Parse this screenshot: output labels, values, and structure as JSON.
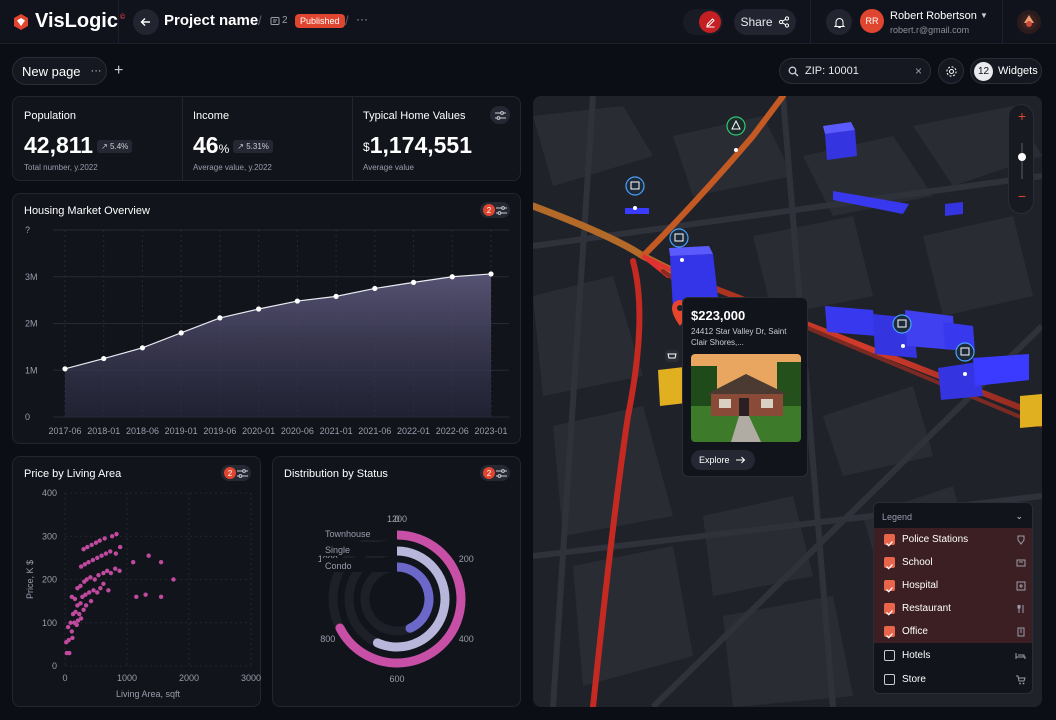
{
  "app": {
    "name": "VisLogic",
    "trademark": "©"
  },
  "header": {
    "project_name": "Project name",
    "page_count": "2",
    "status": "Published",
    "more": "···",
    "share_label": "Share",
    "user": {
      "initials": "RR",
      "name": "Robert Robertson",
      "email": "robert.r@gmail.com"
    }
  },
  "toolbar": {
    "page_name": "New page",
    "page_more": "···",
    "add_page": "+",
    "search_value": "ZIP: 10001",
    "search_clear": "×",
    "widgets_count": "12",
    "widgets_label": "Widgets"
  },
  "stats": [
    {
      "label": "Population",
      "value": "42,811",
      "change": "↗ 5.4%",
      "sub": "Total number, y.2022"
    },
    {
      "label": "Income",
      "value": "46",
      "unit": "%",
      "change": "↗ 5.31%",
      "sub": "Average value, y.2022"
    },
    {
      "label": "Typical Home Values",
      "currency": "$",
      "value": "1,174,551",
      "sub": "Average value"
    }
  ],
  "housing": {
    "title": "Housing Market Overview",
    "badge": "2"
  },
  "scatter_card": {
    "title": "Price by Living Area",
    "badge": "2"
  },
  "status_card": {
    "title": "Distribution by Status",
    "badge": "2"
  },
  "chart_data": [
    {
      "type": "area",
      "title": "Housing Market Overview",
      "y_ticks": [
        "0",
        "1M",
        "2M",
        "3M",
        "?"
      ],
      "ylim": [
        0,
        4000000
      ],
      "x_ticks": [
        "2017-06",
        "2018-01",
        "2018-06",
        "2019-01",
        "2019-06",
        "2020-01",
        "2020-06",
        "2021-01",
        "2021-06",
        "2022-01",
        "2022-06",
        "2023-01"
      ],
      "x": [
        0,
        1,
        2,
        3,
        4,
        5,
        6,
        7,
        8,
        9,
        10,
        11
      ],
      "values": [
        1030000,
        1250000,
        1480000,
        1800000,
        2120000,
        2310000,
        2480000,
        2580000,
        2750000,
        2880000,
        3000000,
        3060000
      ],
      "grid": true
    },
    {
      "type": "scatter",
      "title": "Price by Living Area",
      "xlabel": "Living Area, sqft",
      "ylabel": "Price, K $",
      "xlim": [
        0,
        3000
      ],
      "ylim": [
        0,
        400
      ],
      "x_ticks": [
        "0",
        "1000",
        "2000",
        "3000"
      ],
      "y_ticks": [
        "0",
        "100",
        "200",
        "300",
        "400"
      ],
      "points": [
        [
          30,
          30
        ],
        [
          70,
          30
        ],
        [
          20,
          55
        ],
        [
          60,
          60
        ],
        [
          120,
          65
        ],
        [
          110,
          80
        ],
        [
          50,
          90
        ],
        [
          90,
          100
        ],
        [
          150,
          100
        ],
        [
          190,
          95
        ],
        [
          210,
          105
        ],
        [
          260,
          110
        ],
        [
          130,
          120
        ],
        [
          170,
          125
        ],
        [
          230,
          120
        ],
        [
          300,
          130
        ],
        [
          200,
          140
        ],
        [
          250,
          145
        ],
        [
          340,
          140
        ],
        [
          420,
          150
        ],
        [
          110,
          160
        ],
        [
          160,
          155
        ],
        [
          280,
          160
        ],
        [
          330,
          165
        ],
        [
          390,
          170
        ],
        [
          460,
          175
        ],
        [
          520,
          170
        ],
        [
          570,
          180
        ],
        [
          620,
          190
        ],
        [
          700,
          175
        ],
        [
          200,
          180
        ],
        [
          250,
          185
        ],
        [
          310,
          195
        ],
        [
          350,
          200
        ],
        [
          410,
          205
        ],
        [
          480,
          200
        ],
        [
          540,
          210
        ],
        [
          620,
          215
        ],
        [
          680,
          220
        ],
        [
          740,
          215
        ],
        [
          810,
          225
        ],
        [
          880,
          220
        ],
        [
          260,
          230
        ],
        [
          320,
          235
        ],
        [
          380,
          240
        ],
        [
          450,
          245
        ],
        [
          520,
          250
        ],
        [
          590,
          255
        ],
        [
          660,
          260
        ],
        [
          730,
          265
        ],
        [
          820,
          260
        ],
        [
          300,
          270
        ],
        [
          360,
          275
        ],
        [
          430,
          280
        ],
        [
          500,
          285
        ],
        [
          560,
          290
        ],
        [
          640,
          295
        ],
        [
          760,
          300
        ],
        [
          1100,
          240
        ],
        [
          1350,
          255
        ],
        [
          1550,
          240
        ],
        [
          1750,
          200
        ],
        [
          1550,
          160
        ],
        [
          1300,
          165
        ],
        [
          1150,
          160
        ],
        [
          890,
          275
        ],
        [
          830,
          305
        ]
      ],
      "grid": true
    },
    {
      "type": "radial_bar",
      "title": "Distribution by Status",
      "categories": [
        "Townhouse",
        "Single",
        "Condo"
      ],
      "values": [
        810,
        680,
        520
      ],
      "axis_ticks": [
        "0",
        "200",
        "400",
        "600",
        "800",
        "1000",
        "1200"
      ],
      "max": 1200,
      "colors": [
        "#c84fa6",
        "#b9b6dc",
        "#6c68c9"
      ]
    }
  ],
  "map_popup": {
    "price": "$223,000",
    "address": "24412 Star Valley Dr, Saint Clair Shores,...",
    "explore_label": "Explore"
  },
  "legend": {
    "title": "Legend",
    "items": [
      {
        "label": "Police Stations",
        "checked": true,
        "icon": "police-icon"
      },
      {
        "label": "School",
        "checked": true,
        "icon": "school-icon"
      },
      {
        "label": "Hospital",
        "checked": true,
        "icon": "hospital-icon"
      },
      {
        "label": "Restaurant",
        "checked": true,
        "icon": "restaurant-icon"
      },
      {
        "label": "Office",
        "checked": true,
        "icon": "office-icon"
      },
      {
        "label": "Hotels",
        "checked": false,
        "icon": "hotel-icon"
      },
      {
        "label": "Store",
        "checked": false,
        "icon": "cart-icon"
      }
    ]
  },
  "colors": {
    "accent": "#e0452f",
    "area": "#4b4868",
    "building": "#3b3bff"
  }
}
